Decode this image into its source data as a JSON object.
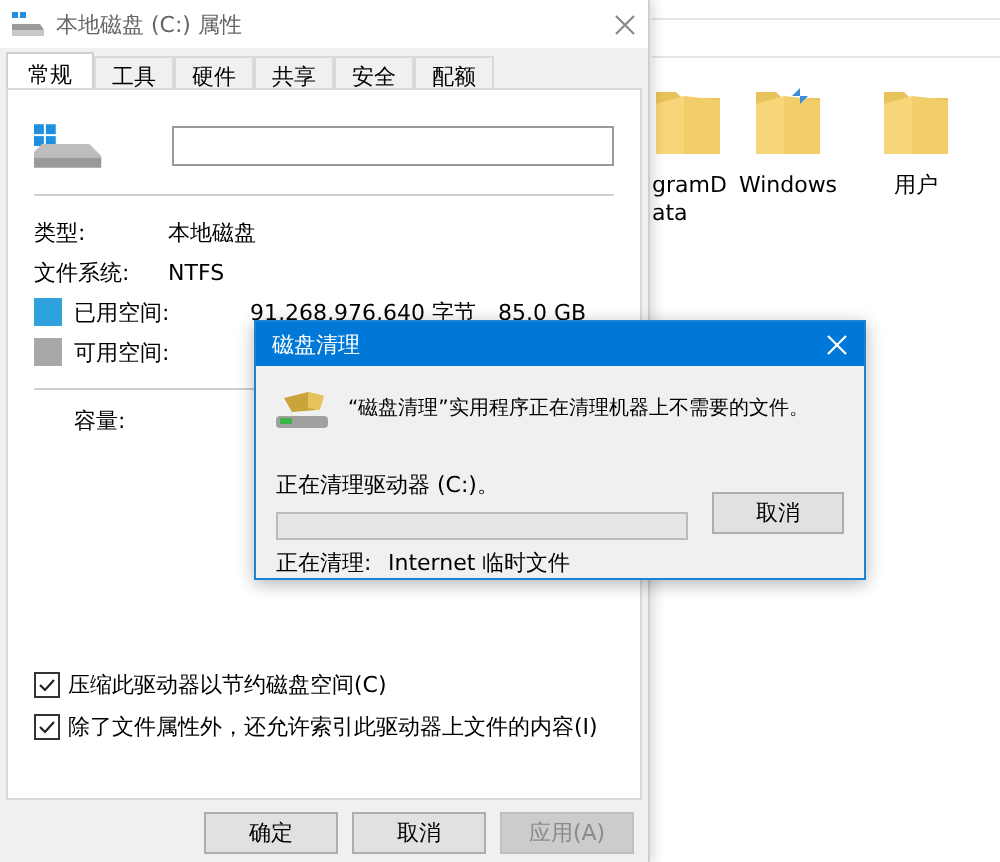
{
  "explorer": {
    "folders": [
      {
        "label_lines": [
          "gramD",
          "ata"
        ],
        "kind": "plain"
      },
      {
        "label_lines": [
          "Windows"
        ],
        "kind": "compressed"
      },
      {
        "label_lines": [
          "用户"
        ],
        "kind": "plain"
      }
    ]
  },
  "properties": {
    "title": "本地磁盘 (C:) 属性",
    "tabs": [
      {
        "label": "常规",
        "selected": true
      },
      {
        "label": "工具",
        "selected": false
      },
      {
        "label": "硬件",
        "selected": false
      },
      {
        "label": "共享",
        "selected": false
      },
      {
        "label": "安全",
        "selected": false
      },
      {
        "label": "配额",
        "selected": false
      }
    ],
    "info": [
      {
        "label": "类型:",
        "value": "本地磁盘"
      },
      {
        "label": "文件系统:",
        "value": "NTFS"
      }
    ],
    "space": [
      {
        "label": "已用空间:",
        "bytes": "91,268,976,640 字节",
        "size": "85.0 GB",
        "color": "#2ea3dc"
      },
      {
        "label": "可用空间:",
        "color": "#a8a8a8"
      }
    ],
    "capacity_label": "容量:",
    "checkboxes": [
      {
        "label": "压缩此驱动器以节约磁盘空间(C)",
        "checked": true
      },
      {
        "label": "除了文件属性外，还允许索引此驱动器上文件的内容(I)",
        "checked": true
      }
    ],
    "buttons": [
      {
        "label": "确定",
        "disabled": false
      },
      {
        "label": "取消",
        "disabled": false
      },
      {
        "label": "应用(A)",
        "disabled": true
      }
    ]
  },
  "dialog": {
    "title": "磁盘清理",
    "message": "“磁盘清理”实用程序正在清理机器上不需要的文件。",
    "status": "正在清理驱动器 (C:)。",
    "progress": {
      "level": 0
    },
    "cancel": "取消",
    "current_label": "正在清理:",
    "current_value": "Internet 临时文件"
  }
}
